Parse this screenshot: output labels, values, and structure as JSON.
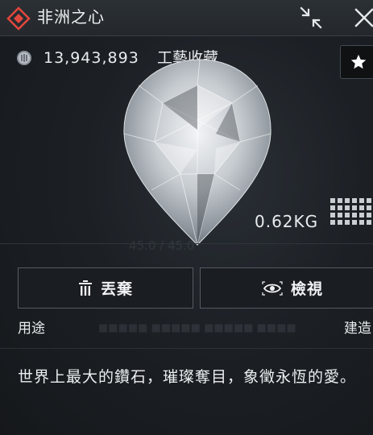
{
  "header": {
    "title": "非洲之心"
  },
  "item": {
    "value": "13,943,893",
    "category": "工藝收藏",
    "weight": "0.62KG"
  },
  "actions": {
    "discard_label": "丟棄",
    "inspect_label": "檢視"
  },
  "usage": {
    "label": "用途",
    "craft_label": "建造"
  },
  "description": "世界上最大的鑽石，璀璨奪目，象徵永恆的愛。",
  "icons": {
    "logo": "diamond-logo-icon",
    "collapse": "collapse-arrows-icon",
    "close": "close-icon",
    "coin": "coin-icon",
    "favorite": "star-icon",
    "discard": "trash-icon",
    "inspect": "eye-icon",
    "weight": "weight-grid-icon"
  },
  "colors": {
    "accent": "#e2473c",
    "background": "#131518",
    "header": "#24282c",
    "text": "#e9ecee"
  }
}
